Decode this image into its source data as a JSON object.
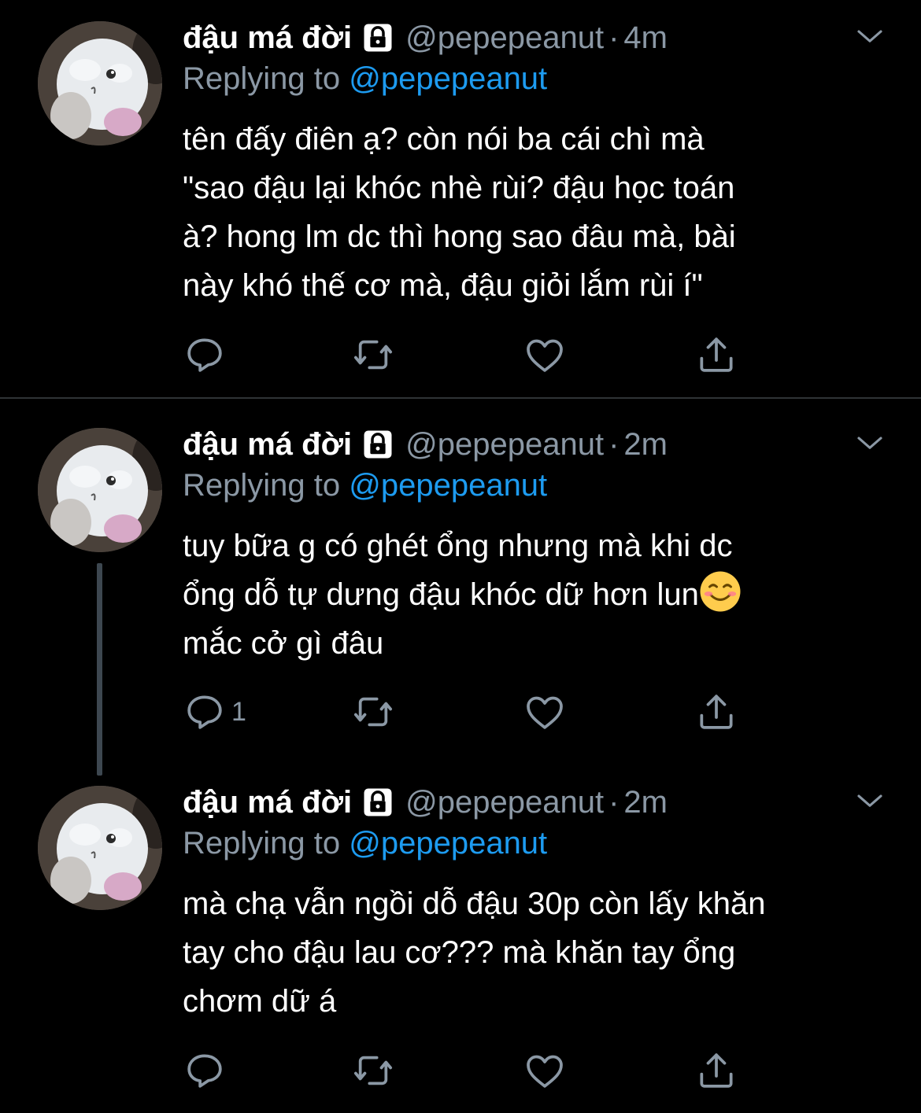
{
  "tweets": [
    {
      "name": "đậu má đời",
      "handle": "@pepepeanut",
      "dot": "·",
      "time": "4m",
      "replying_prefix": "Replying to ",
      "replying_to": "@pepepeanut",
      "text": "tên đấy điên ạ? còn nói ba cái chì mà\n\"sao đậu lại khóc nhè rùi? đậu học toán\nà? hong lm dc thì hong sao đâu mà, bài\nnày khó thế cơ mà, đậu giỏi lắm rùi í\"",
      "reply_count": ""
    },
    {
      "name": "đậu má đời",
      "handle": "@pepepeanut",
      "dot": "·",
      "time": "2m",
      "replying_prefix": "Replying to ",
      "replying_to": "@pepepeanut",
      "text_line1": "tuy bữa g có ghét ổng nhưng mà khi dc",
      "text_line2": "ổng dỗ tự dưng đậu khóc dữ hơn lun",
      "emoji": "smiling-face-emoji",
      "text_line3": "mắc cở gì đâu",
      "reply_count": "1"
    },
    {
      "name": "đậu má đời",
      "handle": "@pepepeanut",
      "dot": "·",
      "time": "2m",
      "replying_prefix": "Replying to ",
      "replying_to": "@pepepeanut",
      "text": "mà chạ vẫn ngồi dỗ đậu 30p còn lấy khăn\ntay cho đậu lau cơ??? mà khăn tay ổng\nchơm dữ á",
      "reply_count": ""
    }
  ],
  "icons": [
    "lock-icon",
    "chevron-down-icon",
    "reply-icon",
    "retweet-icon",
    "like-icon",
    "share-icon"
  ],
  "colors": {
    "background": "#000000",
    "text": "#ffffff",
    "secondary": "#8b98a5",
    "mention": "#1d9bf0",
    "divider": "#2f3336",
    "thread_line": "#3d4750"
  }
}
